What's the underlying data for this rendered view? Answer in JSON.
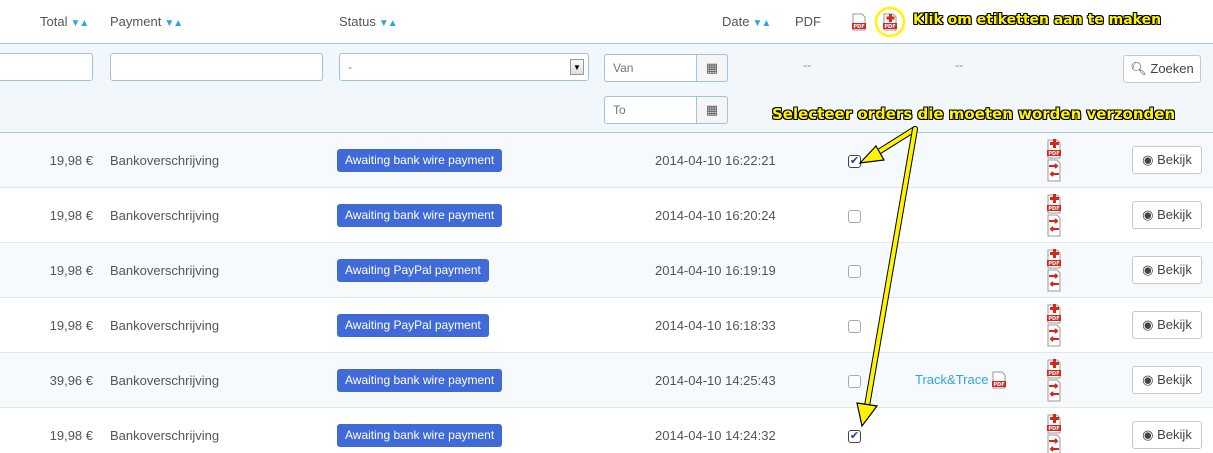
{
  "header": {
    "total": "Total",
    "payment": "Payment",
    "status": "Status",
    "date": "Date",
    "pdf": "PDF",
    "sort_glyph": "▼▲"
  },
  "filters": {
    "status_select": "-",
    "date_from_placeholder": "Van",
    "date_to_placeholder": "To",
    "dash": "--",
    "search_label": "Zoeken"
  },
  "callouts": {
    "create_labels": "Klik om etiketten aan te maken",
    "select_orders": "Selecteer orders die moeten worden verzonden"
  },
  "rows": [
    {
      "total": "19,98 €",
      "payment": "Bankoverschrijving",
      "status": "Awaiting bank wire payment",
      "date": "2014-04-10 16:22:21",
      "checked": true,
      "track": ""
    },
    {
      "total": "19,98 €",
      "payment": "Bankoverschrijving",
      "status": "Awaiting bank wire payment",
      "date": "2014-04-10 16:20:24",
      "checked": false,
      "track": ""
    },
    {
      "total": "19,98 €",
      "payment": "Bankoverschrijving",
      "status": "Awaiting PayPal payment",
      "date": "2014-04-10 16:19:19",
      "checked": false,
      "track": ""
    },
    {
      "total": "19,98 €",
      "payment": "Bankoverschrijving",
      "status": "Awaiting PayPal payment",
      "date": "2014-04-10 16:18:33",
      "checked": false,
      "track": ""
    },
    {
      "total": "39,96 €",
      "payment": "Bankoverschrijving",
      "status": "Awaiting bank wire payment",
      "date": "2014-04-10 14:25:43",
      "checked": false,
      "track": "Track&Trace"
    },
    {
      "total": "19,98 €",
      "payment": "Bankoverschrijving",
      "status": "Awaiting bank wire payment",
      "date": "2014-04-10 14:24:32",
      "checked": true,
      "track": ""
    }
  ],
  "view_label": "Bekijk",
  "colors": {
    "badge": "#3f6ad8",
    "link": "#2ea5db",
    "callout": "#fff400",
    "pdf_red": "#d7261e"
  }
}
